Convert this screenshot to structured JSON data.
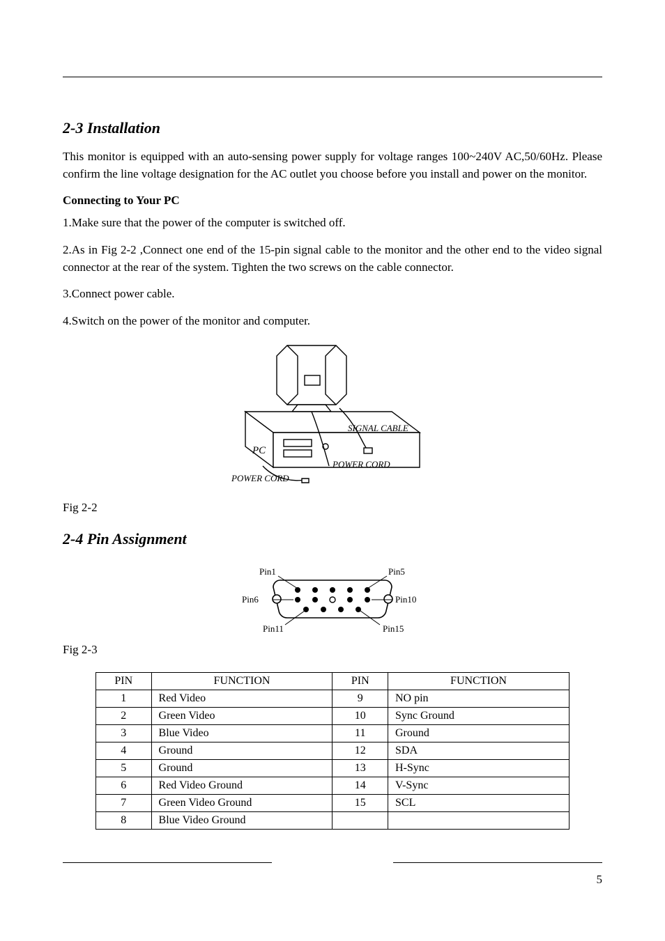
{
  "section1": {
    "title": "2-3 Installation",
    "p1": "This monitor is equipped with an auto-sensing power supply for voltage ranges 100~240V AC,50/60Hz. Please confirm the line voltage designation for the AC outlet you choose before you install and power on the monitor.",
    "sub": "Connecting to Your PC",
    "step1": "1.Make sure that the power of the computer is switched off.",
    "step2": "2.As in Fig 2-2 ,Connect one end of the 15-pin signal cable to the monitor and the other end to the video signal connector at the rear of the system. Tighten the two screws on the cable connector.",
    "step3": "3.Connect power cable.",
    "step4": "4.Switch on the power of the monitor and computer.",
    "fig_caption": "Fig 2-2"
  },
  "section2": {
    "title": "2-4 Pin Assignment",
    "fig_caption": "Fig 2-3",
    "table": {
      "head": [
        "PIN",
        "FUNCTION",
        "PIN",
        "FUNCTION"
      ],
      "rows": [
        [
          "1",
          "Red Video",
          "9",
          "NO pin"
        ],
        [
          "2",
          "Green Video",
          "10",
          "Sync Ground"
        ],
        [
          "3",
          "Blue Video",
          "11",
          "Ground"
        ],
        [
          "4",
          "Ground",
          "12",
          "SDA"
        ],
        [
          "5",
          "Ground",
          "13",
          "H-Sync"
        ],
        [
          "6",
          "Red Video Ground",
          "14",
          "V-Sync"
        ],
        [
          "7",
          "Green Video Ground",
          "15",
          "SCL"
        ],
        [
          "8",
          "Blue Video Ground",
          "",
          ""
        ]
      ]
    }
  },
  "diagram_labels": {
    "signal_cable": "SIGNAL CABLE",
    "pc": "PC",
    "power_cord_1": "POWER CORD",
    "power_cord_2": "POWER CORD"
  },
  "connector_labels": {
    "pin1": "Pin1",
    "pin5": "Pin5",
    "pin6": "Pin6",
    "pin10": "Pin10",
    "pin11": "Pin11",
    "pin15": "Pin15"
  },
  "page_number": "5"
}
